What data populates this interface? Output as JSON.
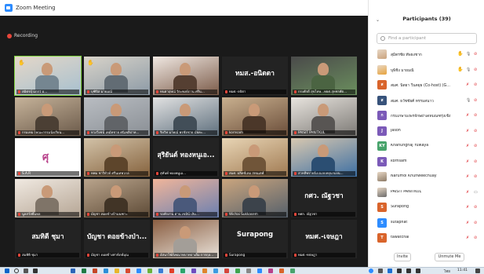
{
  "window": {
    "title": "Zoom Meeting",
    "minimize": "–",
    "maximize": "▢",
    "close": "✕"
  },
  "recording": {
    "label": "Recording"
  },
  "tiles": [
    {
      "name": "สมิตรบุ์ แกกว่ อ...",
      "kind": "photo",
      "palette": [
        "#a7c0cf",
        "#e4d7c8"
      ],
      "hand": true,
      "active": true
    },
    {
      "name": "บุฑิปิส มายมณ์",
      "kind": "photo",
      "palette": [
        "#8c9aa6",
        "#d8d3c9"
      ],
      "hand": true
    },
    {
      "name": "ทนตาฤษณ์ จิระพงษ์ภาน ศรีน...",
      "kind": "photo",
      "palette": [
        "#7a5a48",
        "#f0e8e2"
      ]
    },
    {
      "name": "ทมศ.-ลบิตา",
      "kind": "text",
      "text": "ทมส.-อนิตตา"
    },
    {
      "name": "กรงศักดิ์ สุขไทษ...ทยศ.สุหชรศัต...",
      "kind": "photo",
      "palette": [
        "#6b8f5e",
        "#4a4a4a"
      ]
    },
    {
      "name": "กรมเทม (คณะกรรมนังเรียน...",
      "kind": "photo",
      "palette": [
        "#6b5a4a",
        "#c6b39a"
      ]
    },
    {
      "name": "ทวงวีงชน์ เทมัทชาย ศนิเพลิปาท...",
      "kind": "photo",
      "palette": [
        "#8a8f95",
        "#b9bdc2"
      ]
    },
    {
      "name": "ริษวิท มาพณ์ พรชัยชาย มัยคะ...",
      "kind": "photo",
      "palette": [
        "#5e6f7d",
        "#e2e2e2"
      ]
    },
    {
      "name": "kornsam",
      "kind": "photo",
      "palette": [
        "#6b4e3a",
        "#c9b08f"
      ]
    },
    {
      "name": "PAISIT PANITKUL",
      "kind": "photo",
      "palette": [
        "#7d7a76",
        "#e8e4de"
      ]
    },
    {
      "name": "S.A.R",
      "kind": "logo"
    },
    {
      "name": "ทพม ชาวิทัวท์ ศรีนเทพวกล",
      "kind": "photo",
      "palette": [
        "#85623d",
        "#d2c2a8"
      ]
    },
    {
      "name": "สุทันท์ ทองทมูเอ...",
      "kind": "text",
      "text": "สุริยันต์ ทองหนูเอ..."
    },
    {
      "name": "สมศ. ผลิทช์เทอ สทนเตพ์",
      "kind": "photo",
      "palette": [
        "#a07a52",
        "#e8d5b5"
      ]
    },
    {
      "name": "สวทลีพรายจ์เบณจบทยุนรมงน...",
      "kind": "photo",
      "palette": [
        "#3d6fa3",
        "#d8c8b0"
      ]
    },
    {
      "name": "นูลสวัสธิ์แหล",
      "kind": "photo",
      "palette": [
        "#b5a594",
        "#f0e9e1"
      ]
    },
    {
      "name": "มัญชา คอยข้างป้ามนฑาะ",
      "kind": "photo",
      "palette": [
        "#5d4a36",
        "#b9a48c"
      ]
    },
    {
      "name": "รอทักงาน ด่าน เขมิน์ เลิม...",
      "kind": "photo",
      "palette": [
        "#6a7fb0",
        "#f0b59a"
      ]
    },
    {
      "name": "Wichai Sukkasem",
      "kind": "photo",
      "palette": [
        "#55606b",
        "#caa57e"
      ]
    },
    {
      "name": "ทศก. ณัฐวชา",
      "kind": "text",
      "text": "กศว. ณัฐวชา"
    },
    {
      "name": "สมทิติ ชุมา",
      "kind": "text",
      "text": "สมทิตี ชุมา"
    },
    {
      "name": "มัญชา ดอยข้างท่าท์ภท์มุณ",
      "kind": "text",
      "text": "บัญชา ดอยข้างป่า..."
    },
    {
      "name": "อัสนาไพ์ส์เพณาทบาทปาเต็ม การกุล...",
      "kind": "photo",
      "palette": [
        "#e9e2d9",
        "#8a5e42"
      ]
    },
    {
      "name": "Surapong",
      "kind": "text",
      "text": "Surapong"
    },
    {
      "name": "ทมศ.-ทจษฎา",
      "kind": "text",
      "text": "ทมศ.-เจษฎา"
    }
  ],
  "participants_panel": {
    "title": "Participants (39)",
    "collapse_icon": "chevron-down-icon",
    "search_placeholder": "Find a participant",
    "invite_label": "Invite",
    "unmute_me_label": "Unmute Me",
    "people": [
      {
        "name": "สุมิตรชัย ทัพธงชาก",
        "initial": "",
        "color": "#c9a27c",
        "photo": true,
        "hand": true,
        "mic": "on",
        "cam": "off"
      },
      {
        "name": "บุพิชิง มายมณิ",
        "initial": "",
        "color": "#e7a33c",
        "photo": true,
        "hand": true,
        "mic": "on",
        "cam": "off"
      },
      {
        "name": "สมศ. นิตยา วีนตยุธ (Co-host) (G...",
        "initial": "ส",
        "color": "#d9642b",
        "photo": false,
        "hand": false,
        "mic": "off",
        "cam": "off"
      },
      {
        "name": "สมศ. ธวัชชัยศ์ ทรรมสนาว",
        "initial": "ส",
        "color": "#37527a",
        "photo": false,
        "hand": false,
        "mic": "on",
        "cam": "off"
      },
      {
        "name": "กรมเกษามงพรจักษย่าเดทมณฑรุ่งเช้ง",
        "initial": "ก",
        "color": "#7b5ab8",
        "photo": false,
        "hand": false,
        "mic": "off",
        "cam": "off"
      },
      {
        "name": "Jason",
        "initial": "J",
        "color": "#7b5ab8",
        "photo": false,
        "hand": false,
        "mic": "off",
        "cam": "off"
      },
      {
        "name": "Khanungnaj Yuwaya",
        "initial": "KY",
        "color": "#47a36b",
        "photo": false,
        "hand": false,
        "mic": "off",
        "cam": "off"
      },
      {
        "name": "kornsam",
        "initial": "K",
        "color": "#7b5ab8",
        "photo": false,
        "hand": false,
        "mic": "off",
        "cam": "off"
      },
      {
        "name": "Narumol Khunweechuay",
        "initial": "",
        "color": "#8c7a66",
        "photo": true,
        "hand": false,
        "mic": "off",
        "cam": "off"
      },
      {
        "name": "PAISIT PANITKUL",
        "initial": "",
        "color": "#6b6b6b",
        "photo": true,
        "hand": false,
        "mic": "off",
        "cam": "on"
      },
      {
        "name": "Surapong",
        "initial": "S",
        "color": "#d9642b",
        "photo": false,
        "hand": false,
        "mic": "off",
        "cam": "off"
      },
      {
        "name": "sutaphat",
        "initial": "S",
        "color": "#2d8cff",
        "photo": false,
        "hand": false,
        "mic": "off",
        "cam": "off"
      },
      {
        "name": "tawatchai",
        "initial": "T",
        "color": "#d9642b",
        "photo": false,
        "hand": false,
        "mic": "off",
        "cam": "off"
      }
    ]
  },
  "taskbar": {
    "lang": "ไทย",
    "time": "11:41"
  }
}
